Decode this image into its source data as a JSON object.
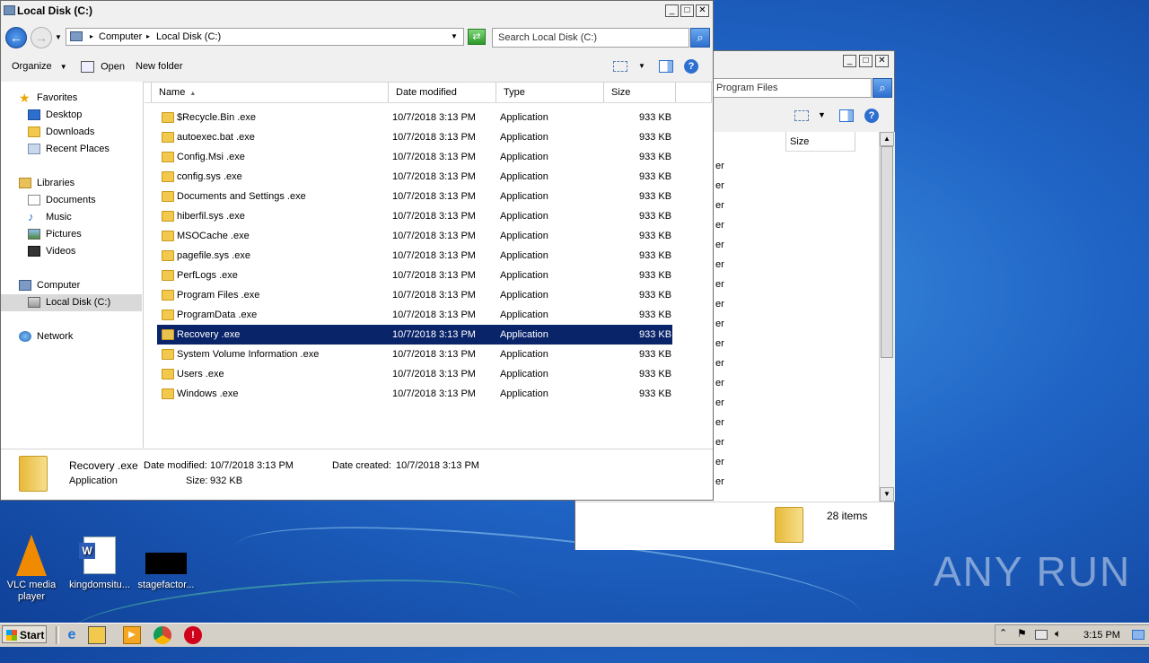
{
  "back_window": {
    "address_text": "Program Files",
    "size_header": "Size",
    "row_fragment": "er",
    "status": "28 items"
  },
  "main_window": {
    "title": "Local Disk (C:)",
    "breadcrumb": [
      "Computer",
      "Local Disk (C:)"
    ],
    "search_placeholder": "Search Local Disk (C:)",
    "toolbar": {
      "organize": "Organize",
      "open": "Open",
      "new_folder": "New folder"
    },
    "nav": {
      "favorites": "Favorites",
      "desktop": "Desktop",
      "downloads": "Downloads",
      "recent_places": "Recent Places",
      "libraries": "Libraries",
      "documents": "Documents",
      "music": "Music",
      "pictures": "Pictures",
      "videos": "Videos",
      "computer": "Computer",
      "local_disk": "Local Disk (C:)",
      "network": "Network"
    },
    "columns": {
      "name": "Name",
      "date": "Date modified",
      "type": "Type",
      "size": "Size"
    },
    "files": [
      {
        "name": "$Recycle.Bin .exe",
        "date": "10/7/2018 3:13 PM",
        "type": "Application",
        "size": "933 KB"
      },
      {
        "name": "autoexec.bat .exe",
        "date": "10/7/2018 3:13 PM",
        "type": "Application",
        "size": "933 KB"
      },
      {
        "name": "Config.Msi .exe",
        "date": "10/7/2018 3:13 PM",
        "type": "Application",
        "size": "933 KB"
      },
      {
        "name": "config.sys .exe",
        "date": "10/7/2018 3:13 PM",
        "type": "Application",
        "size": "933 KB"
      },
      {
        "name": "Documents and Settings .exe",
        "date": "10/7/2018 3:13 PM",
        "type": "Application",
        "size": "933 KB"
      },
      {
        "name": "hiberfil.sys .exe",
        "date": "10/7/2018 3:13 PM",
        "type": "Application",
        "size": "933 KB"
      },
      {
        "name": "MSOCache .exe",
        "date": "10/7/2018 3:13 PM",
        "type": "Application",
        "size": "933 KB"
      },
      {
        "name": "pagefile.sys .exe",
        "date": "10/7/2018 3:13 PM",
        "type": "Application",
        "size": "933 KB"
      },
      {
        "name": "PerfLogs .exe",
        "date": "10/7/2018 3:13 PM",
        "type": "Application",
        "size": "933 KB"
      },
      {
        "name": "Program Files .exe",
        "date": "10/7/2018 3:13 PM",
        "type": "Application",
        "size": "933 KB"
      },
      {
        "name": "ProgramData .exe",
        "date": "10/7/2018 3:13 PM",
        "type": "Application",
        "size": "933 KB"
      },
      {
        "name": "Recovery .exe",
        "date": "10/7/2018 3:13 PM",
        "type": "Application",
        "size": "933 KB"
      },
      {
        "name": "System Volume Information .exe",
        "date": "10/7/2018 3:13 PM",
        "type": "Application",
        "size": "933 KB"
      },
      {
        "name": "Users .exe",
        "date": "10/7/2018 3:13 PM",
        "type": "Application",
        "size": "933 KB"
      },
      {
        "name": "Windows .exe",
        "date": "10/7/2018 3:13 PM",
        "type": "Application",
        "size": "933 KB"
      }
    ],
    "selected_index": 11,
    "details": {
      "name": "Recovery .exe",
      "type": "Application",
      "modified_label": "Date modified:",
      "modified_value": "10/7/2018 3:13 PM",
      "created_label": "Date created:",
      "created_value": "10/7/2018 3:13 PM",
      "size_label": "Size:",
      "size_value": "932 KB"
    }
  },
  "desktop_icons": [
    {
      "label": "VLC media player",
      "icon": "vlc-icon"
    },
    {
      "label": "kingdomsitu...",
      "icon": "word-doc-icon"
    },
    {
      "label": "stagefactor...",
      "icon": "black-file-icon"
    }
  ],
  "taskbar": {
    "start": "Start",
    "clock": "3:15 PM",
    "pinned": [
      "ie-icon",
      "explorer-icon",
      "media-player-icon",
      "chrome-icon",
      "stop-icon"
    ]
  },
  "watermark": "ANY RUN",
  "colors": {
    "selection": "#0a246a",
    "desktop": "#1f63c4",
    "folder": "#f2c94c"
  }
}
